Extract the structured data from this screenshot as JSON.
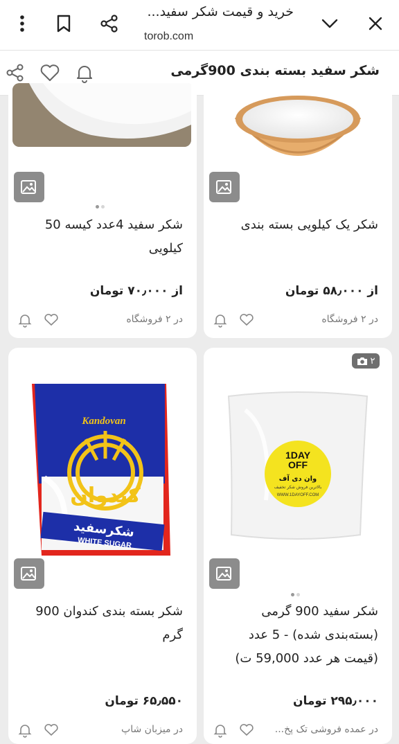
{
  "browser": {
    "title": "خرید و قیمت شکر سفید...",
    "url": "torob.com"
  },
  "header": {
    "title": "شکر سفید بسته بندی 900گرمی"
  },
  "products": [
    {
      "title_line1": "شکر یک کیلویی بسته بندی",
      "title_line2": "",
      "title_line3": "",
      "price": "از ۵۸٫۰۰۰ تومان",
      "stores": "در ۲ فروشگاه"
    },
    {
      "title_line1": "شکر سفید 4عدد کیسه 50",
      "title_line2": "کیلویی",
      "title_line3": "",
      "price": "از ۷۰٫۰۰۰ تومان",
      "stores": "در ۲ فروشگاه"
    },
    {
      "badge": "۲",
      "image_text": {
        "brand_top": "1DAY",
        "brand_bottom": "OFF",
        "tagline": "وان دی آف",
        "subline": "بالاترین فروش شکر تخفیف",
        "website": "WWW.1DAYOFF.COM"
      },
      "title_line1": "شکر سفید 900 گرمی",
      "title_line2": "(بسته‌بندی شده) - 5 عدد",
      "title_line3": "(قیمت هر عدد 59,000 ت)",
      "price": "۲۹۵٫۰۰۰ تومان",
      "stores": "در عمده فروشی تک پخ..."
    },
    {
      "image_text": {
        "brand_latin": "Kandovan",
        "brand_fa": "کندوان",
        "product_fa": "شکرسفید",
        "product_en": "WHITE SUGAR"
      },
      "title_line1": "شکر بسته بندی کندوان 900",
      "title_line2": "گرم",
      "title_line3": "",
      "price": "۶۵٫۵۵۰ تومان",
      "stores": "در میزبان شاپ"
    }
  ],
  "colors": {
    "background": "#ececec",
    "card": "#ffffff",
    "gallery_button": "#8c8c8c",
    "sticker_yellow": "#f4e31f",
    "package_blue": "#1d2fa8",
    "package_red": "#e2261d"
  }
}
